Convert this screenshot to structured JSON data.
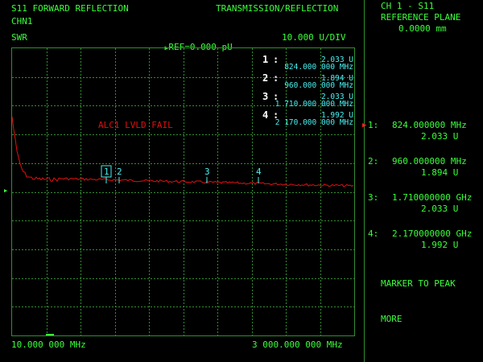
{
  "header": {
    "measurement": "S11 FORWARD REFLECTION",
    "mode": "TRANSMISSION/REFLECTION",
    "channel": "CHN1",
    "format": "SWR",
    "reference": "REF=0.000 pU",
    "scale": "10.000 U/DIV"
  },
  "graph": {
    "error_message": "ALC1 LVLD FAIL",
    "start_freq": "10.000 000 MHz",
    "stop_freq": "3 000.000 000 MHz",
    "marker_readouts": [
      {
        "num": "1",
        "value": "2.033 U",
        "freq": "824.000 000 MHz"
      },
      {
        "num": "2",
        "value": "1.894 U",
        "freq": "960.000 000 MHz"
      },
      {
        "num": "3",
        "value": "2.033 U",
        "freq": "1 710.000 000 MHz"
      },
      {
        "num": "4",
        "value": "1.992 U",
        "freq": "2 170.000 000 MHz"
      }
    ],
    "trace_labels": [
      "1",
      "2",
      "3",
      "4"
    ]
  },
  "softkeys": {
    "title1": "CH 1 - S11",
    "title2": "REFERENCE PLANE",
    "title3": "0.0000 mm",
    "markers": [
      {
        "label": "1:",
        "freq": "824.000000 MHz",
        "value": "2.033 U"
      },
      {
        "label": "2:",
        "freq": "960.000000 MHz",
        "value": "1.894 U"
      },
      {
        "label": "3:",
        "freq": "1.710000000 GHz",
        "value": "2.033 U"
      },
      {
        "label": "4:",
        "freq": "2.170000000 GHz",
        "value": "1.992 U"
      }
    ],
    "marker_to_peak": "MARKER TO PEAK",
    "more": "MORE"
  },
  "colors": {
    "background": "#000000",
    "graticule": "#2f8f2f",
    "annotation": "#3aff3a",
    "marker_text": "#48f0f0",
    "trace": "#e01010",
    "active_marker": "#ff2020"
  }
}
